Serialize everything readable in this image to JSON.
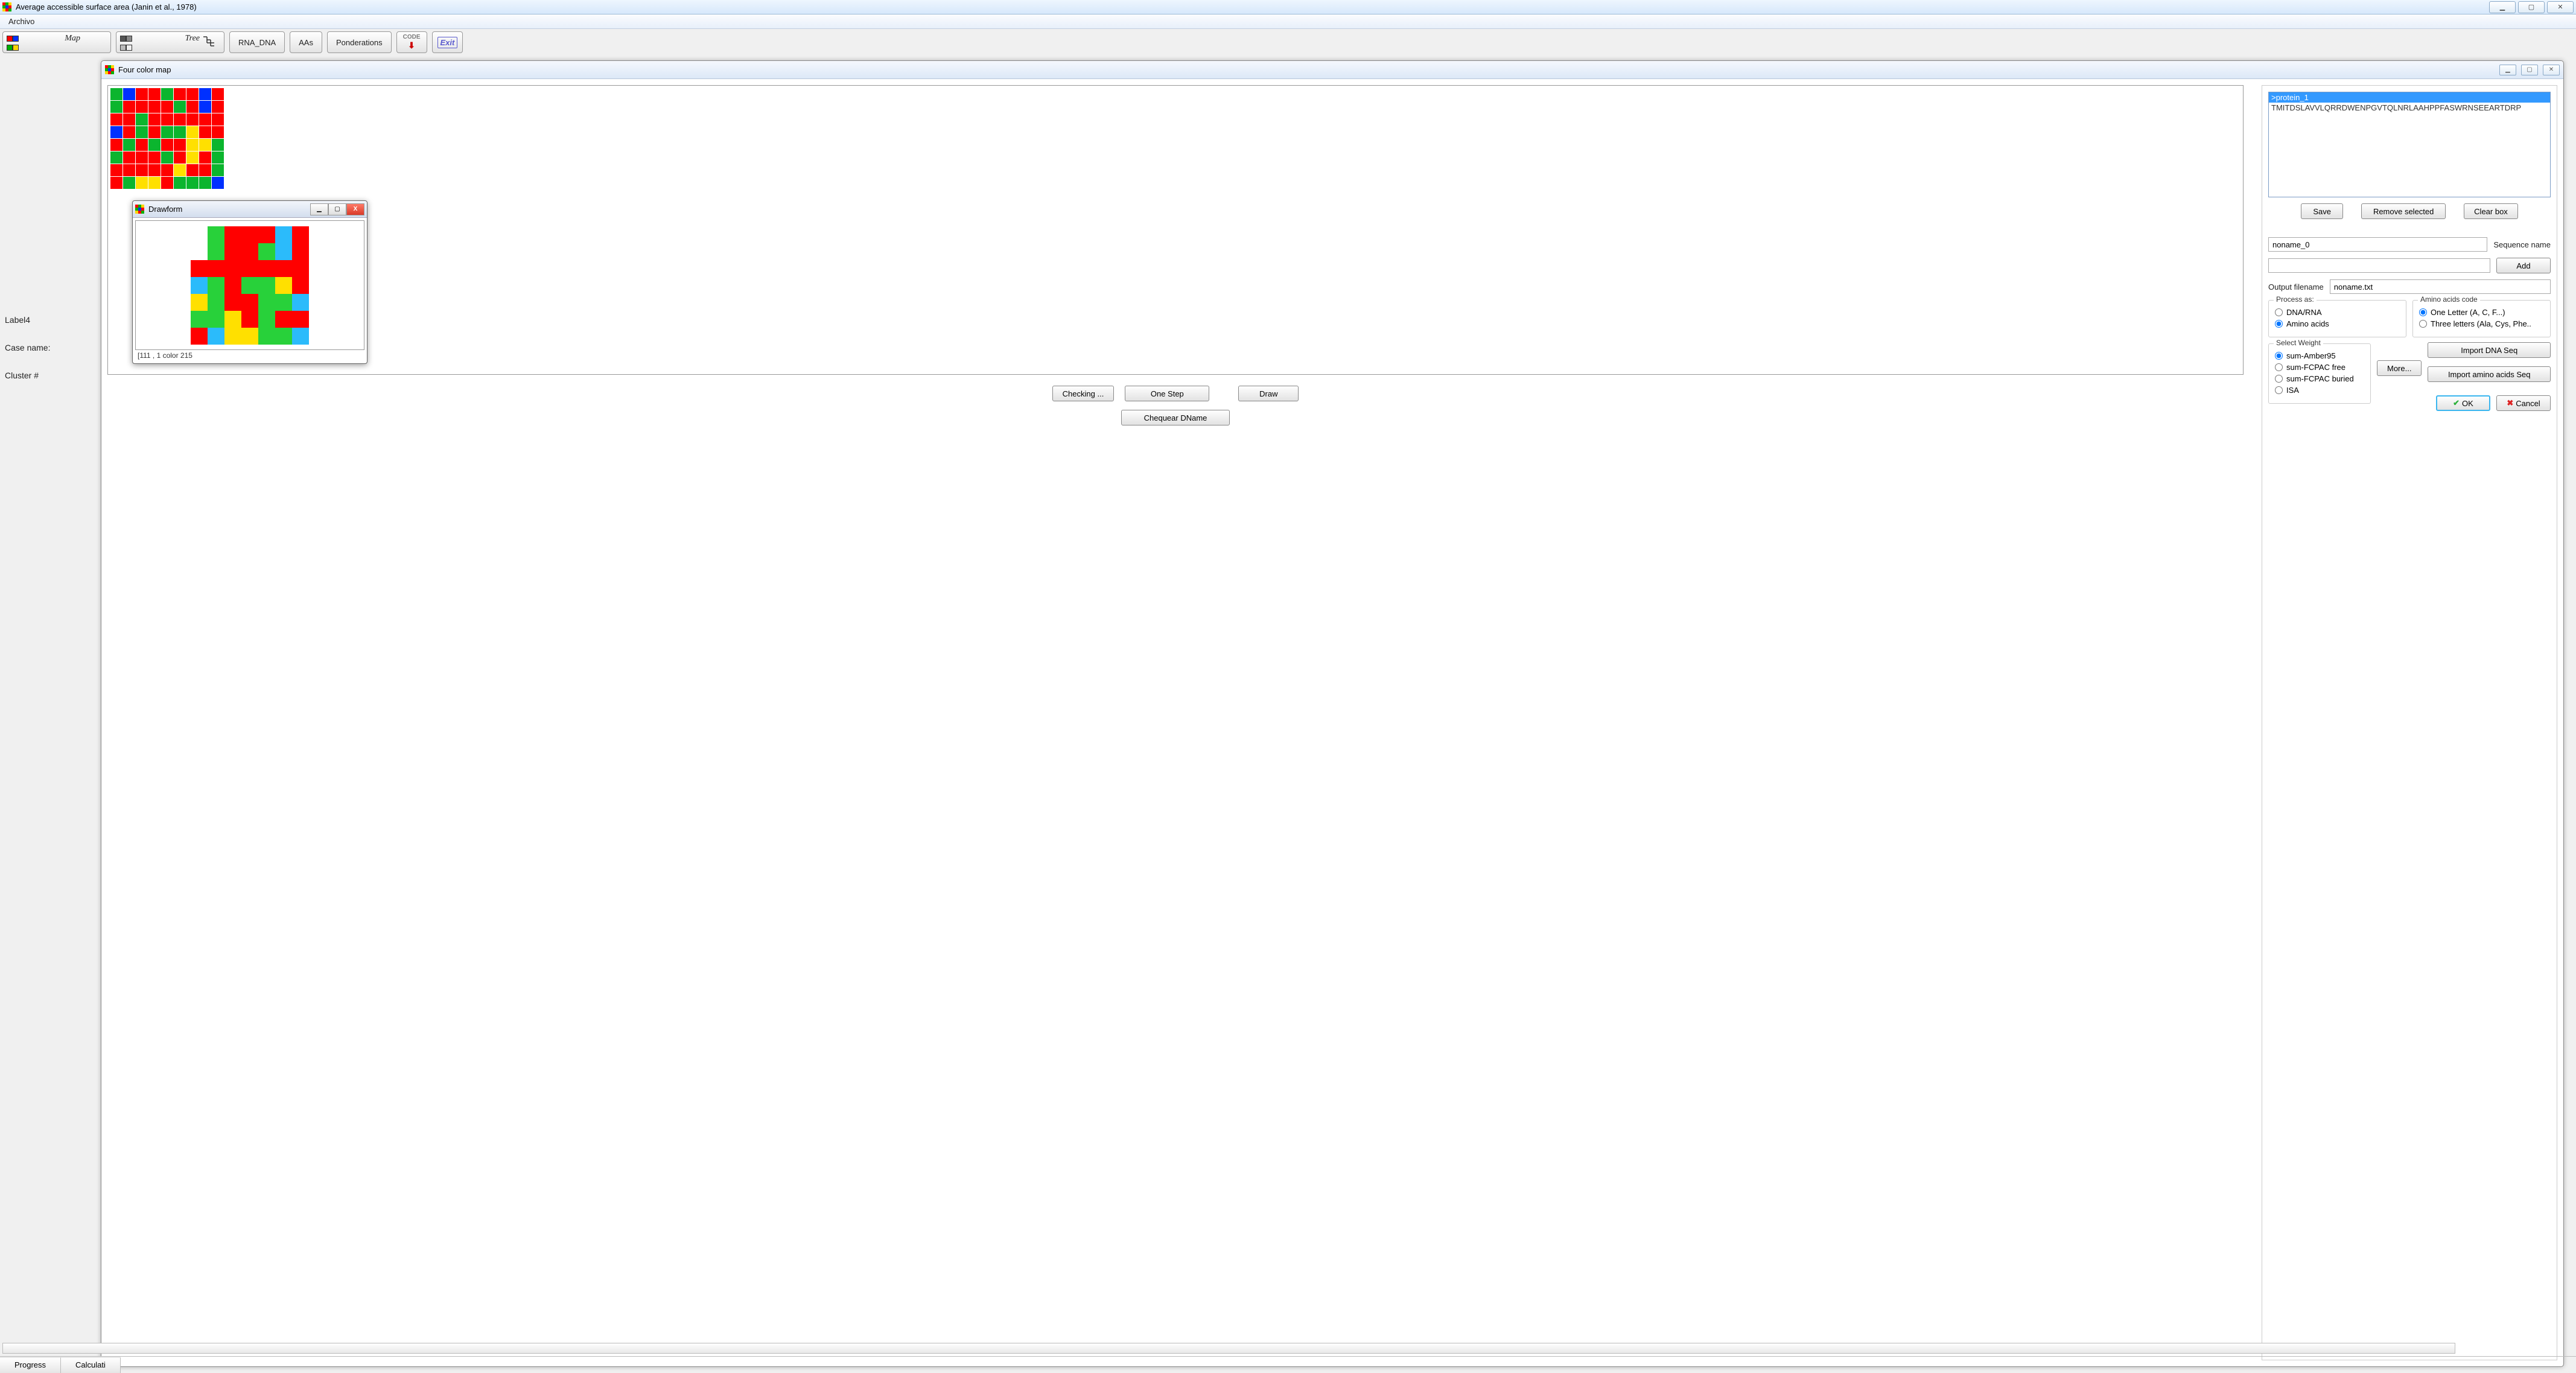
{
  "titlebar": {
    "title": "Average accessible surface area (Janin et al., 1978)"
  },
  "menubar": {
    "file": "Archivo"
  },
  "toolbar": {
    "map_btn": "Map",
    "tree_btn": "Tree",
    "rna_dna": "RNA_DNA",
    "aas": "AAs",
    "ponderations": "Ponderations",
    "code_label": "CODE",
    "exit_label": "Exit"
  },
  "four_color_map": {
    "title": "Four color map",
    "buttons": {
      "checking": "Checking ...",
      "one_step": "One Step",
      "draw": "Draw",
      "chequear": "Chequear DName"
    },
    "top_grid": [
      [
        "g",
        "b",
        "r",
        "r",
        "g",
        "r",
        "r",
        "b",
        "r"
      ],
      [
        "g",
        "r",
        "r",
        "r",
        "r",
        "g",
        "r",
        "b",
        "r"
      ],
      [
        "r",
        "r",
        "g",
        "r",
        "r",
        "r",
        "r",
        "r",
        "r"
      ],
      [
        "b",
        "r",
        "g",
        "r",
        "g",
        "g",
        "y",
        "r",
        "r"
      ],
      [
        "r",
        "g",
        "r",
        "g",
        "r",
        "r",
        "y",
        "y",
        "g"
      ],
      [
        "g",
        "r",
        "r",
        "r",
        "g",
        "r",
        "y",
        "r",
        "g"
      ],
      [
        "r",
        "r",
        "r",
        "r",
        "r",
        "y",
        "r",
        "r",
        "g"
      ],
      [
        "r",
        "g",
        "y",
        "y",
        "r",
        "g",
        "g",
        "g",
        "b"
      ]
    ]
  },
  "drawform": {
    "title": "Drawform",
    "status": "[111 , 1 color 215",
    "grid": [
      [
        "",
        "g",
        "r",
        "r",
        "r",
        "sk",
        "r"
      ],
      [
        "",
        "g",
        "r",
        "r",
        "g",
        "sk",
        "r"
      ],
      [
        "r",
        "r",
        "r",
        "r",
        "r",
        "r",
        "r"
      ],
      [
        "sk",
        "g",
        "r",
        "g",
        "g",
        "y",
        "r"
      ],
      [
        "y",
        "g",
        "r",
        "r",
        "g",
        "g",
        "sk"
      ],
      [
        "g",
        "g",
        "y",
        "r",
        "g",
        "r",
        "r"
      ],
      [
        "r",
        "sk",
        "y",
        "y",
        "g",
        "g",
        "sk"
      ]
    ]
  },
  "sequence_panel": {
    "selected_header": ">protein_1",
    "sequence": "TMITDSLAVVLQRRDWENPGVTQLNRLAAHPPFASWRNSEEARTDRP",
    "buttons": {
      "save": "Save",
      "remove": "Remove selected",
      "clear": "Clear box",
      "add": "Add",
      "more": "More...",
      "import_dna": "Import DNA Seq",
      "import_aa": "Import amino acids Seq",
      "ok": "OK",
      "cancel": "Cancel"
    },
    "seq_name_value": "noname_0",
    "seq_name_label": "Sequence name",
    "add_value": "",
    "output_filename_label": "Output filename",
    "output_filename_value": "noname.txt",
    "process_as": {
      "title": "Process as:",
      "dna_rna": "DNA/RNA",
      "amino_acids": "Amino acids"
    },
    "aa_code": {
      "title": "Amino acids code",
      "one_letter": "One Letter (A, C, F...)",
      "three_letters": "Three letters (Ala, Cys, Phe.."
    },
    "select_weight": {
      "title": "Select Weight",
      "amber": "sum-Amber95",
      "fcpac_free": "sum-FCPAC free",
      "fcpac_buried": "sum-FCPAC buried",
      "isa": "ISA"
    }
  },
  "side_labels": {
    "label4": "Label4",
    "case_name": "Case name:",
    "cluster": "Cluster #"
  },
  "tabs": {
    "progress": "Progress",
    "calculation": "Calculati"
  }
}
